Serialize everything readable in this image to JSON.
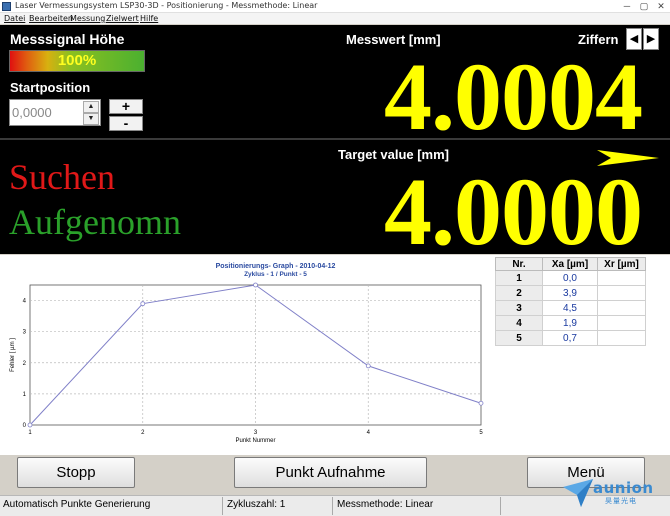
{
  "window": {
    "title": "Laser Vermessungsystem LSP30-3D - Positionierung - Messmethode: Linear",
    "minimize": "─",
    "maximize": "▢",
    "close": "✕"
  },
  "menu": [
    {
      "label": "Datei"
    },
    {
      "label": "Bearbeiten"
    },
    {
      "label": "Messung"
    },
    {
      "label": "Zielwert"
    },
    {
      "label": "Hilfe"
    }
  ],
  "signal": {
    "label": "Messsignal Höhe",
    "percent_text": "100%",
    "level": 1.0
  },
  "start_position": {
    "label": "Startposition",
    "value": "0,0000",
    "plus": "+",
    "minus": "-",
    "spin_up": "▲",
    "spin_down": "▼"
  },
  "measurement": {
    "label": "Messwert [mm]",
    "value": "4.0004",
    "digits_label": "Ziffern",
    "prev": "◀",
    "next": "▶"
  },
  "target": {
    "label": "Target value [mm]",
    "value": "4.0000",
    "status_searching": "Suchen",
    "status_recorded": "Aufgenomn"
  },
  "colors": {
    "value_yellow": "#ffff00",
    "searching_red": "#e01818",
    "recorded_green": "#2aa02a",
    "graph_line": "#8080c8"
  },
  "chart_data": {
    "type": "line",
    "title": "Positionierungs- Graph - 2010-04-12",
    "subtitle": "Zyklus - 1 / Punkt - 5",
    "xlabel": "Punkt Nummer",
    "ylabel": "Fehler [ µm ]",
    "x": [
      1,
      2,
      3,
      4,
      5
    ],
    "y": [
      0.0,
      3.9,
      4.5,
      1.9,
      0.7
    ],
    "xlim": [
      1,
      5
    ],
    "ylim": [
      0,
      4.5
    ],
    "xticks": [
      "1",
      "2",
      "3",
      "4",
      "5"
    ],
    "yticks": [
      "0",
      "1",
      "2",
      "3",
      "4"
    ],
    "grid": true
  },
  "table": {
    "headers": [
      "Nr.",
      "Xa [µm]",
      "Xr [µm]"
    ],
    "rows": [
      {
        "nr": "1",
        "xa": "0,0",
        "xr": ""
      },
      {
        "nr": "2",
        "xa": "3,9",
        "xr": ""
      },
      {
        "nr": "3",
        "xa": "4,5",
        "xr": ""
      },
      {
        "nr": "4",
        "xa": "1,9",
        "xr": ""
      },
      {
        "nr": "5",
        "xa": "0,7",
        "xr": ""
      }
    ]
  },
  "buttons": {
    "stop": "Stopp",
    "record": "Punkt Aufnahme",
    "menu": "Menü"
  },
  "statusbar": {
    "mode": "Automatisch Punkte Generierung",
    "cycle": "Zykluszahl: 1",
    "method": "Messmethode: Linear"
  },
  "watermark": {
    "brand": "aunion",
    "sub": "昊量光电"
  }
}
